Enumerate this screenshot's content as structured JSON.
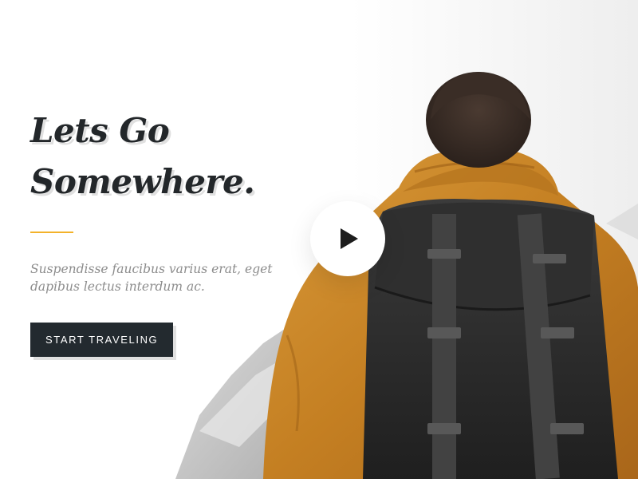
{
  "hero": {
    "headline_line1": "Lets Go",
    "headline_line2": "Somewhere.",
    "subtext": "Suspendisse faucibus varius erat, eget dapibus lectus interdum ac.",
    "cta_label": "START TRAVELING"
  },
  "media": {
    "play_icon": "play-icon",
    "image": "hiker-with-backpack-photo"
  },
  "colors": {
    "accent": "#f3b22a",
    "text_dark": "#23272a",
    "button_bg": "#232a2f",
    "subtext": "#8c8c8c",
    "jacket": "#c8862a"
  }
}
